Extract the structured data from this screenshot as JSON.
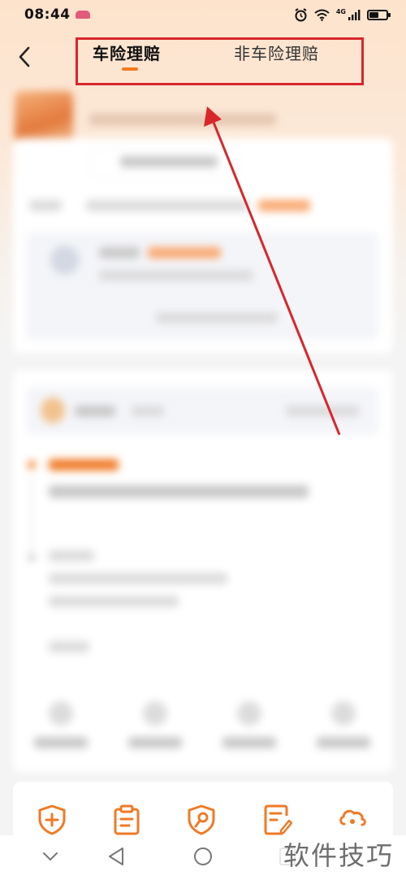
{
  "status_bar": {
    "time": "08:44",
    "network": "4G"
  },
  "header": {
    "tabs": [
      {
        "label": "车险理赔",
        "active": true
      },
      {
        "label": "非车险理赔",
        "active": false
      }
    ],
    "highlight_color": "#d8262b",
    "accent": "#f47a1f"
  },
  "bottom_bar": {
    "icons": [
      "add-shield-icon",
      "clipboard-icon",
      "shield-wrench-icon",
      "edit-document-icon",
      "cloud-icon"
    ],
    "color": "#f07a26"
  },
  "watermark": "软件技巧"
}
